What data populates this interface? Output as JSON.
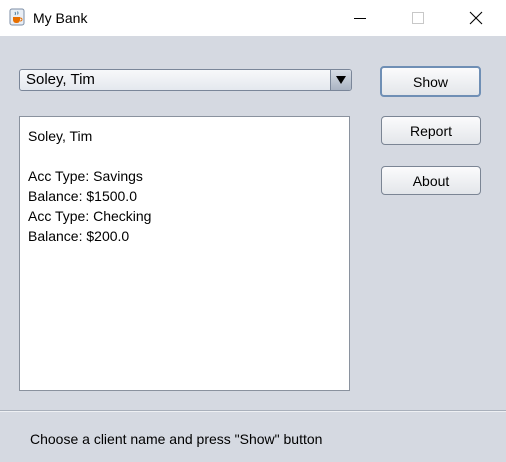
{
  "window": {
    "title": "My Bank",
    "icon": "java-cup-icon",
    "controls": [
      "minimize-icon",
      "maximize-icon",
      "close-icon"
    ]
  },
  "client_select": {
    "selected": "Soley, Tim"
  },
  "buttons": {
    "show": "Show",
    "report": "Report",
    "about": "About"
  },
  "details": {
    "lines": [
      "Soley, Tim",
      "",
      "Acc Type: Savings",
      "Balance: $1500.0",
      "Acc Type: Checking",
      "Balance: $200.0"
    ]
  },
  "status": {
    "text": "Choose a client name and press \"Show\" button"
  }
}
